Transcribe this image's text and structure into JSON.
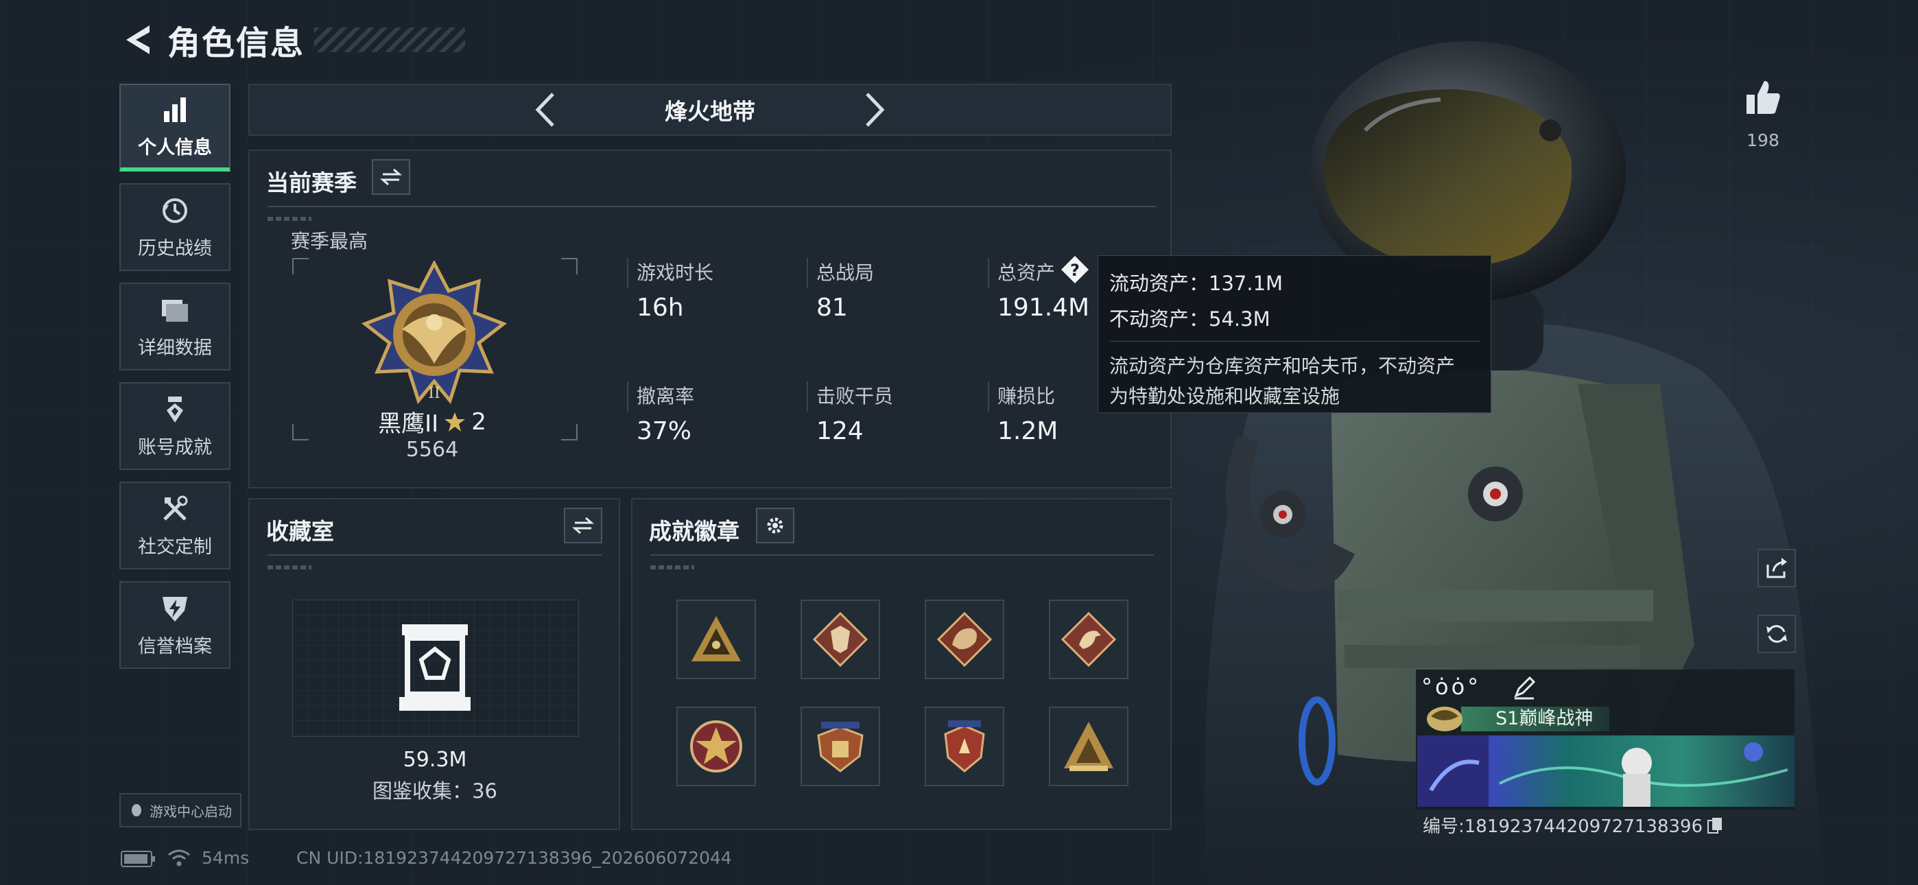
{
  "header": {
    "title": "角色信息"
  },
  "sidebar": {
    "items": [
      {
        "label": "个人信息",
        "icon": "bar-chart-icon",
        "active": true
      },
      {
        "label": "历史战绩",
        "icon": "history-clock-icon"
      },
      {
        "label": "详细数据",
        "icon": "folder-icon"
      },
      {
        "label": "账号成就",
        "icon": "achievement-ribbon-icon"
      },
      {
        "label": "社交定制",
        "icon": "tools-icon"
      },
      {
        "label": "信誉档案",
        "icon": "shield-lightning-icon"
      }
    ],
    "game_center": "游戏中心启动"
  },
  "mode": {
    "title": "烽火地带"
  },
  "season": {
    "title": "当前赛季",
    "best_label": "赛季最高",
    "rank_name": "黑鹰II",
    "rank_stars": "2",
    "rank_score": "5564",
    "stats": [
      {
        "label": "游戏时长",
        "value": "16h"
      },
      {
        "label": "总战局",
        "value": "81"
      },
      {
        "label": "总资产",
        "value": "191.4M"
      },
      {
        "label": "撤离率",
        "value": "37%"
      },
      {
        "label": "击败干员",
        "value": "124"
      },
      {
        "label": "赚损比",
        "value": "1.2M"
      }
    ]
  },
  "tooltip": {
    "liquid": "流动资产：137.1M",
    "fixed": "不动资产：54.3M",
    "desc_line1": "流动资产为仓库资产和哈夫币，不动资产",
    "desc_line2": "为特勤处设施和收藏室设施"
  },
  "collection": {
    "title": "收藏室",
    "value": "59.3M",
    "count": "图鉴收集：36"
  },
  "achievements": {
    "title": "成就徽章",
    "badges": [
      "pyramid-badge-icon",
      "wolf-badge-icon",
      "dragon-badge-icon",
      "bird-badge-icon",
      "star-medal-icon",
      "winged-shield-badge-icon",
      "star-shield-badge-icon",
      "mountain-badge-icon"
    ]
  },
  "status": {
    "ping": "54ms",
    "uid": "CN UID:181923744209727138396_202606072044"
  },
  "social": {
    "likes": "198"
  },
  "card": {
    "signature": "°ȯȯ°",
    "title": "S1巅峰战神",
    "id": "编号:181923744209727138396"
  },
  "colors": {
    "accent": "#3fd98a",
    "panel": "#1f2831",
    "background": "#1a222b"
  }
}
